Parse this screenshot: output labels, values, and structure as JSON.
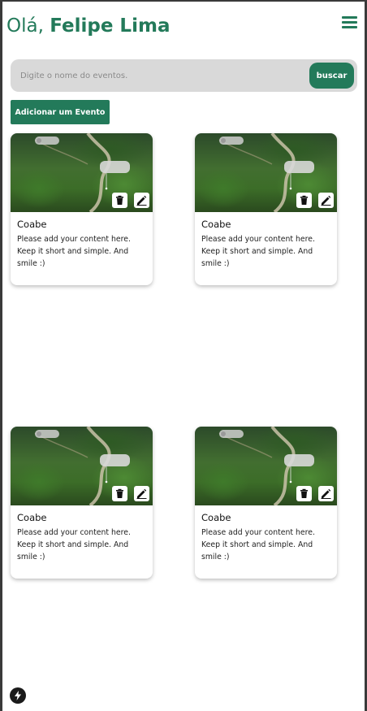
{
  "header": {
    "greeting_prefix": "Olá, ",
    "user_name": "Felipe Lima"
  },
  "search": {
    "placeholder": "Digite o nome do eventos.",
    "value": "",
    "button_label": "buscar"
  },
  "actions": {
    "add_event_label": "Adicionar um Evento"
  },
  "cards": [
    {
      "title": "Coabe",
      "text": "Please add your content here. Keep it short and simple. And smile :)"
    },
    {
      "title": "Coabe",
      "text": "Please add your content here. Keep it short and simple. And smile :)"
    },
    {
      "title": "Coabe",
      "text": "Please add your content here. Keep it short and simple. And smile :)"
    },
    {
      "title": "Coabe",
      "text": "Please add your content here. Keep it short and simple. And smile :)"
    }
  ],
  "icons": {
    "menu": "hamburger-menu-icon",
    "delete": "trash-icon",
    "edit": "pencil-icon",
    "devtools": "lightning-icon"
  },
  "colors": {
    "brand": "#237a5a",
    "search_bg": "#d9d9d9"
  }
}
